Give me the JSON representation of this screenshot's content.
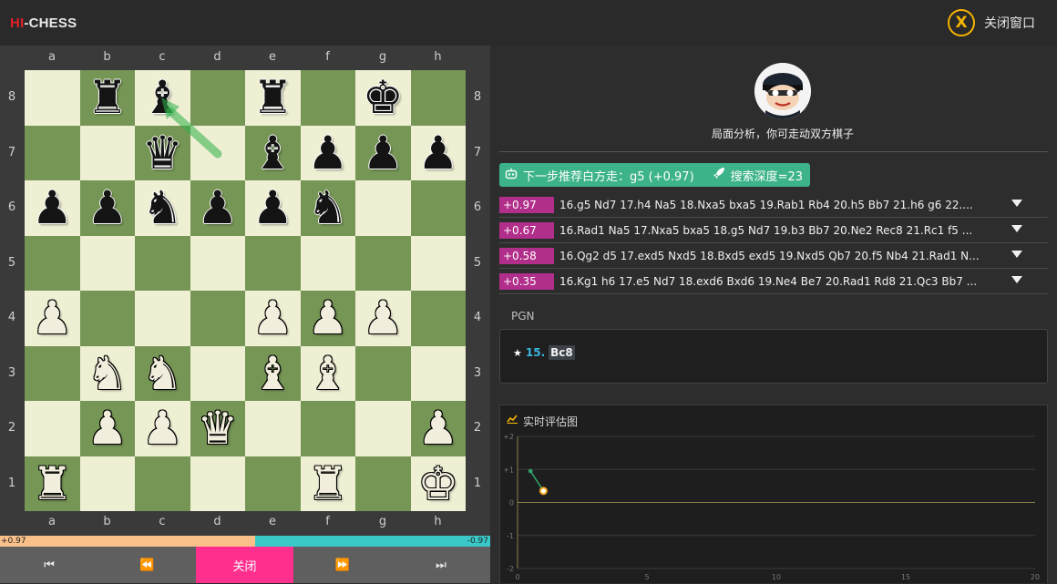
{
  "app": {
    "logo_hi": "HI",
    "logo_rest": "-CHESS",
    "close_window_label": "关闭窗口",
    "close_icon_glyph": "X"
  },
  "board": {
    "files": [
      "a",
      "b",
      "c",
      "d",
      "e",
      "f",
      "g",
      "h"
    ],
    "ranks": [
      "8",
      "7",
      "6",
      "5",
      "4",
      "3",
      "2",
      "1"
    ],
    "position": [
      [
        "",
        "bR",
        "bB",
        "",
        "bR",
        "",
        "bK",
        ""
      ],
      [
        "",
        "",
        "bQ",
        "",
        "bB",
        "bP",
        "bP",
        "bP"
      ],
      [
        "bP",
        "bP",
        "bN",
        "bP",
        "bP",
        "bN",
        "",
        ""
      ],
      [
        "",
        "",
        "",
        "",
        "",
        "",
        "",
        ""
      ],
      [
        "wP",
        "",
        "",
        "",
        "wP",
        "wP",
        "wP",
        ""
      ],
      [
        "",
        "wN",
        "wN",
        "",
        "wB",
        "wB",
        "",
        ""
      ],
      [
        "",
        "wP",
        "wP",
        "wQ",
        "",
        "",
        "",
        "wP"
      ],
      [
        "wR",
        "",
        "",
        "",
        "",
        "wR",
        "",
        "wK"
      ]
    ],
    "last_move_arrow": {
      "from": "d7",
      "to": "c8",
      "color": "#2fb24a"
    }
  },
  "eval_bar": {
    "left_label": "+0.97",
    "right_label": "-0.97",
    "white_share": 0.52
  },
  "nav": {
    "first": "⏮",
    "prev": "⏪",
    "close": "关闭",
    "next": "⏩",
    "last": "⏭"
  },
  "side": {
    "analysis_title": "局面分析，你可走动双方棋子",
    "recommendation": {
      "text": "下一步推荐白方走：g5 (+0.97)",
      "depth": "搜索深度=23"
    },
    "lines": [
      {
        "score": "+0.97",
        "moves": "16.g5 Nd7 17.h4 Na5 18.Nxa5 bxa5 19.Rab1 Rb4 20.h5 Bb7 21.h6 g6 22...."
      },
      {
        "score": "+0.67",
        "moves": "16.Rad1 Na5 17.Nxa5 bxa5 18.g5 Nd7 19.b3 Bb7 20.Ne2 Rec8 21.Rc1 f5 ..."
      },
      {
        "score": "+0.58",
        "moves": "16.Qg2 d5 17.exd5 Nxd5 18.Bxd5 exd5 19.Nxd5 Qb7 20.f5 Nb4 21.Rad1 N..."
      },
      {
        "score": "+0.35",
        "moves": "16.Kg1 h6 17.e5 Nd7 18.exd6 Bxd6 19.Ne4 Be7 20.Rad1 Rd8 21.Qc3 Bb7 ..."
      }
    ],
    "pgn_label": "PGN",
    "pgn": {
      "star": "★",
      "num": "15.",
      "san": "Bc8"
    },
    "chart_title": "实时评估图"
  },
  "chart_data": {
    "type": "line",
    "title": "实时评估图",
    "x_ticks": [
      0,
      5,
      10,
      15,
      20
    ],
    "y_ticks": [
      "+2",
      "+1",
      "0",
      "-1",
      "-2"
    ],
    "xlim": [
      0,
      20
    ],
    "ylim": [
      -2,
      2
    ],
    "series": [
      {
        "x": [
          0.5,
          1
        ],
        "y": [
          0.95,
          0.35
        ]
      }
    ],
    "line_color": "#2fa36a",
    "current_point_color": "#f5a623"
  }
}
